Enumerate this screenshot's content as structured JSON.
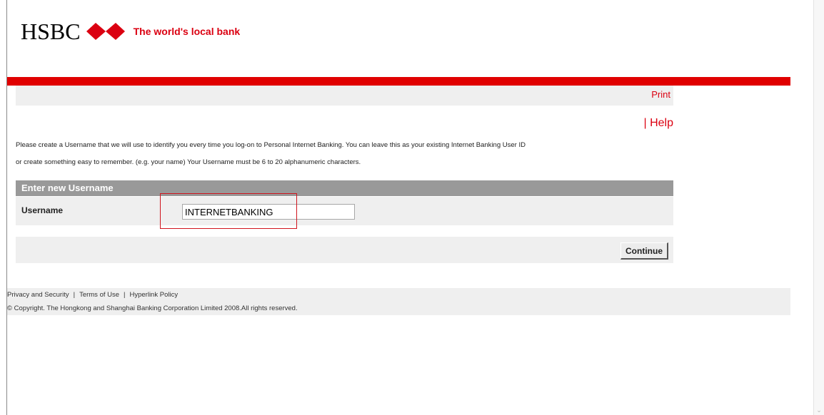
{
  "header": {
    "brand_name": "HSBC",
    "tagline": "The world's local bank"
  },
  "toolbar": {
    "print_label": "Print",
    "help_separator": "|",
    "help_label": "Help"
  },
  "instructions": {
    "line1": "Please create a Username that we will use to identify you every time you log-on to Personal Internet Banking. You can leave this as your existing Internet Banking User ID",
    "line2": "or create something easy to remember. (e.g. your name) Your Username must be 6 to 20 alphanumeric characters."
  },
  "form": {
    "section_title": "Enter new Username",
    "username_label": "Username",
    "username_value": "INTERNETBANKING",
    "continue_label": "Continue"
  },
  "footer": {
    "links": [
      "Privacy and Security",
      "Terms of Use",
      "Hyperlink Policy"
    ],
    "separator": "|",
    "copyright": "© Copyright. The Hongkong and Shanghai Banking Corporation Limited 2008.All rights reserved."
  },
  "colors": {
    "brand_red": "#db0011",
    "bar_red": "#e00000",
    "section_grey": "#999999",
    "panel_grey": "#efefef"
  },
  "icons": {
    "logo": "hsbc-hexagon-logo",
    "scroll_down": "scroll-down-arrow-icon"
  }
}
